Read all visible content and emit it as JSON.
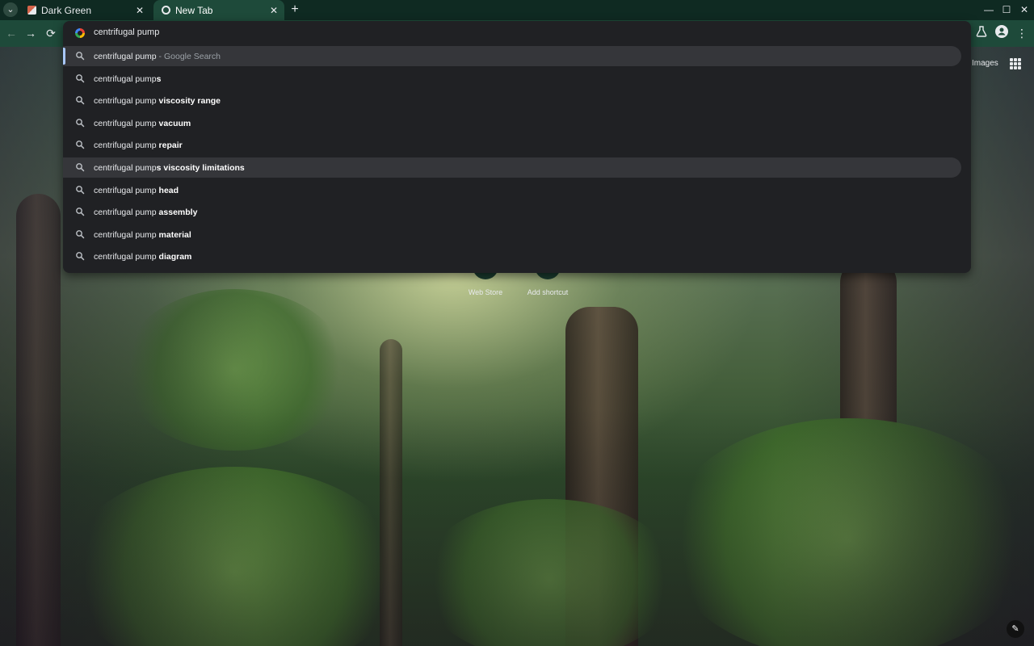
{
  "tabs": [
    {
      "title": "Dark Green",
      "active": false
    },
    {
      "title": "New Tab",
      "active": true
    }
  ],
  "window": {
    "minimize": "—",
    "maximize": "☐",
    "close": "✕"
  },
  "toolbar": {
    "back": "←",
    "forward": "→",
    "reload": "⟳"
  },
  "omnibox": {
    "query": "centrifugal pump",
    "suggestions": [
      {
        "base": "centrifugal pump",
        "bold": "",
        "desc": " - Google Search",
        "selected": true
      },
      {
        "base": "centrifugal pump",
        "bold": "s",
        "desc": ""
      },
      {
        "base": "centrifugal pump ",
        "bold": "viscosity range",
        "desc": ""
      },
      {
        "base": "centrifugal pump ",
        "bold": "vacuum",
        "desc": ""
      },
      {
        "base": "centrifugal pump ",
        "bold": "repair",
        "desc": ""
      },
      {
        "base": "centrifugal pump",
        "bold": "s viscosity limitations",
        "desc": "",
        "hover": true
      },
      {
        "base": "centrifugal pump ",
        "bold": "head",
        "desc": ""
      },
      {
        "base": "centrifugal pump ",
        "bold": "assembly",
        "desc": ""
      },
      {
        "base": "centrifugal pump ",
        "bold": "material",
        "desc": ""
      },
      {
        "base": "centrifugal pump ",
        "bold": "diagram",
        "desc": ""
      }
    ]
  },
  "ntp": {
    "images_link": "Images",
    "shortcuts": [
      {
        "label": "Web Store"
      },
      {
        "label": "Add shortcut"
      }
    ]
  },
  "icons": {
    "tab_search": "chevron-down-icon",
    "suggestion": "search-icon",
    "labs": "flask-icon",
    "profile": "person-icon",
    "menu": "kebab-menu-icon",
    "apps": "apps-grid-icon",
    "edit": "pencil-icon"
  },
  "colors": {
    "frame": "#0f2a22",
    "toolbar": "#1e4a3a",
    "dropdown": "#202124",
    "highlight": "#35363a",
    "selection_bar": "#a8c7fa"
  }
}
